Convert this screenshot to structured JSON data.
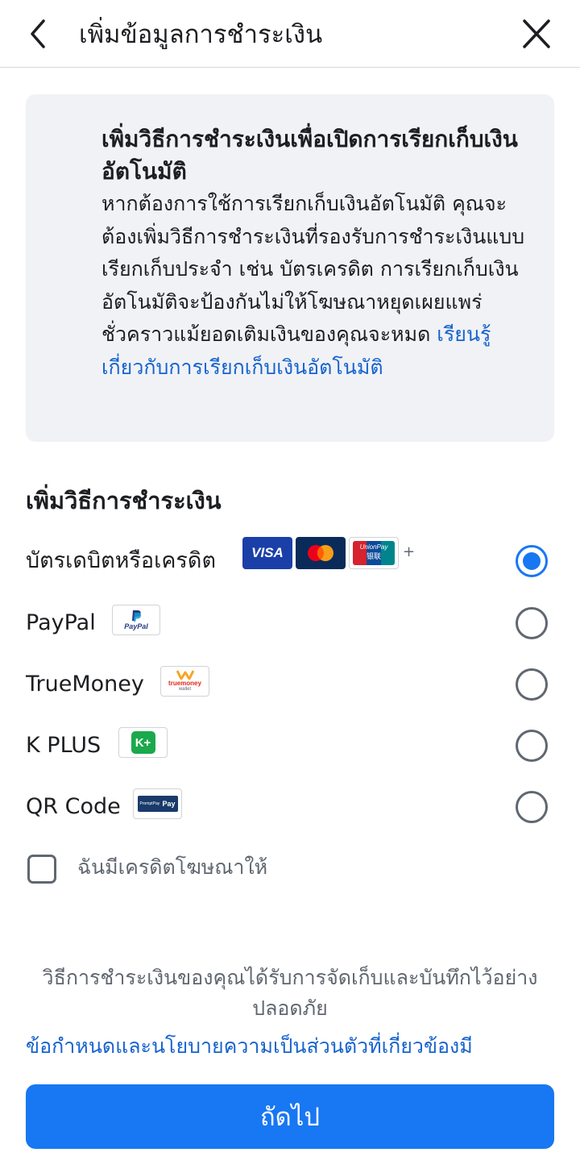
{
  "header": {
    "title": "เพิ่มข้อมูลการชำระเงิน",
    "back_icon": "chevron-left-icon",
    "close_icon": "close-icon"
  },
  "info": {
    "title": "เพิ่มวิธีการชำระเงินเพื่อเปิดการเรียกเก็บเงินอัตโนมัติ",
    "body": "หากต้องการใช้การเรียกเก็บเงินอัตโนมัติ คุณจะต้องเพิ่มวิธีการชำระเงินที่รองรับการชำระเงินแบบเรียกเก็บประจำ เช่น บัตรเครดิต การเรียกเก็บเงินอัตโนมัติจะป้องกันไม่ให้โฆษณาหยุดเผยแพร่ชั่วคราวแม้ยอดเติมเงินของคุณจะหมด ",
    "link": "เรียนรู้เกี่ยวกับการเรียกเก็บเงินอัตโนมัติ"
  },
  "payment": {
    "section_title": "เพิ่มวิธีการชำระเงิน",
    "methods": [
      {
        "label": "บัตรเดบิตหรือเครดิต",
        "selected": true
      },
      {
        "label": "PayPal",
        "selected": false
      },
      {
        "label": "TrueMoney",
        "selected": false
      },
      {
        "label": "K PLUS",
        "selected": false
      },
      {
        "label": "QR Code",
        "selected": false
      }
    ],
    "card_logos": {
      "visa": "VISA",
      "unionpay_top": "UnionPay",
      "unionpay_bottom": "银联",
      "more": "+"
    },
    "paypal_logo": "PayPal",
    "truemoney_logo_top": "truemoney",
    "truemoney_logo_bottom": "wallet",
    "kplus_logo": "K+",
    "promptpay_logo_left": "PromptPay",
    "promptpay_logo_right": "Pay"
  },
  "ad_credit": {
    "label": "ฉันมีเครดิตโฆษณาให้",
    "checked": false
  },
  "footer": {
    "secure_note": "วิธีการชำระเงินของคุณได้รับการจัดเก็บและบันทึกไว้อย่างปลอดภัย",
    "terms_link": "ข้อกำหนดและนโยบายความเป็นส่วนตัวที่เกี่ยวข้องมี",
    "next_button": "ถัดไป"
  },
  "colors": {
    "accent": "#1877f2",
    "link": "#1763cf",
    "card_bg": "#f0f2f5",
    "visa_blue": "#1a1f71",
    "mastercard_bg": "#0a2a5a",
    "kplus_green": "#1ba94c"
  }
}
